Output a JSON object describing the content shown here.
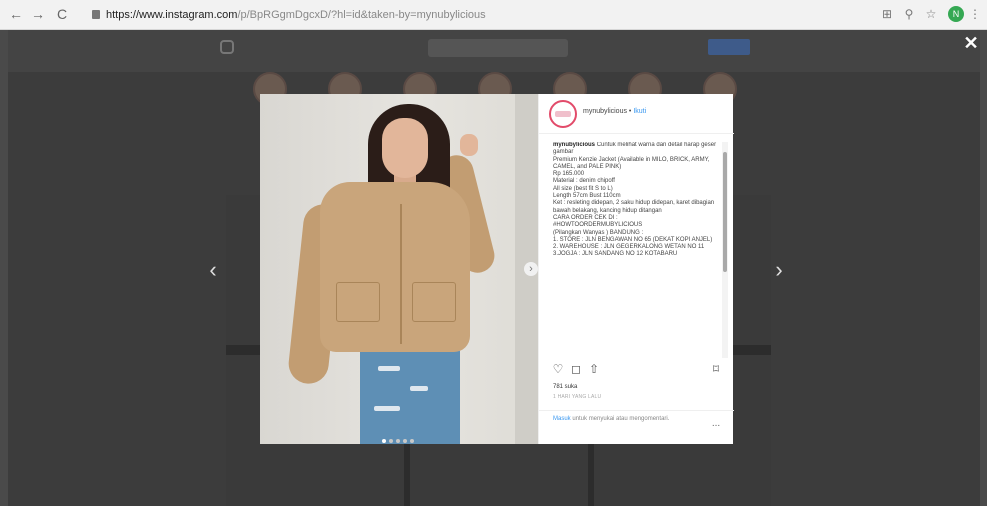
{
  "browser": {
    "url_host": "https://www.instagram.com",
    "url_path": "/p/BpRGgmDgcxD/?hl=id&taken-by=mynubylicious",
    "profile_initial": "N"
  },
  "post": {
    "username": "mynubylicious",
    "follow_label": "Ikuti",
    "caption_user": "mynubylicious",
    "caption_lines": [
      "Cuntuk melihat warna dan detail harap geser gambar",
      "",
      "Premium Kenzie Jacket (Available in MILO, BRICK, ARMY, CAMEL, and PALE PINK)",
      "Rp 165.000",
      "Material : denim chipoff",
      "All size (best fit S to L)",
      "Length 57cm  Bust 110cm",
      "Ket : resleting didepan, 2 saku hidup didepan, karet dibagian bawah belakang, kancing hidup ditangan",
      "",
      "CARA ORDER CEK DI :",
      "#HOWTOORDERMUBYLICIOUS",
      "(Pilangkan Wanyas ) BANDUNG :",
      "1. STORE : JLN BENGAWAN NO 65 (DEKAT KOPI ANJEL)",
      "2. WAREHOUSE : JLN GEGERKALONG WETAN NO 11",
      "3.JOGJA : JLN SANDANG NO 12 KOTABARU"
    ],
    "likes": "781 suka",
    "time": "1 HARI YANG LALU",
    "login_link": "Masuk",
    "login_text": "untuk menyukai atau mengomentari.",
    "more_label": "..."
  },
  "icons": {
    "back": "←",
    "forward": "→",
    "reload": "C",
    "close": "✕",
    "prev": "‹",
    "next": "›",
    "heart": "♡",
    "comment": "◻",
    "share": "⇧",
    "bookmark": "⌑",
    "image_next": "›",
    "translate": "⊞",
    "zoom": "⚲",
    "star": "☆",
    "menu": "⋮"
  },
  "colors": {
    "accent": "#3897f0",
    "jacket": "#c9a57b",
    "overlay": "#3c3c3c"
  }
}
